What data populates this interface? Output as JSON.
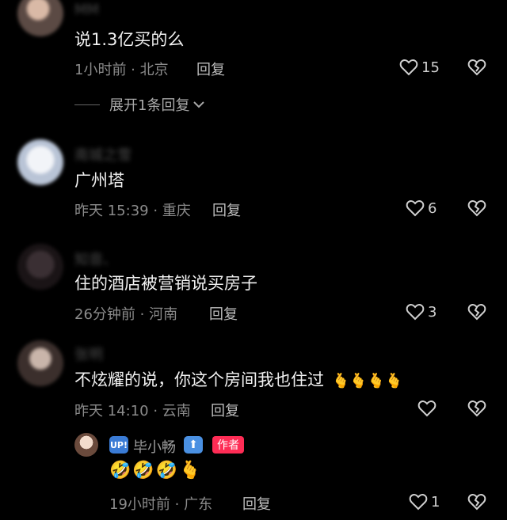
{
  "comments": [
    {
      "username": "MM",
      "text": "说1.3亿买的么",
      "meta": "1小时前 · 北京",
      "reply_label": "回复",
      "likes": "15",
      "expand_label": "展开1条回复"
    },
    {
      "username": "南城之雪",
      "text": "广州塔",
      "meta": "昨天 15:39 · 重庆",
      "reply_label": "回复",
      "likes": "6"
    },
    {
      "username": "知音、",
      "text": "住的酒店被营销说买房子",
      "meta": "26分钟前 · 河南",
      "reply_label": "回复",
      "likes": "3"
    },
    {
      "username": "张明",
      "text": "不炫耀的说，你这个房间我也住过",
      "emojis": "🫰🫰🫰🫰",
      "meta": "昨天 14:10 · 云南",
      "reply_label": "回复",
      "likes": ""
    }
  ],
  "sub_reply": {
    "badge": "UP!",
    "name": "毕小畅",
    "arrow": "⬆",
    "author_tag": "作者",
    "emojis": "🤣🤣🤣🫰",
    "meta": "19小时前 · 广东",
    "reply_label": "回复",
    "likes": "1"
  },
  "icons": {
    "like": "heart-outline-icon",
    "dislike": "broken-heart-icon",
    "expand": "chevron-down-icon"
  },
  "colors": {
    "background": "#000000",
    "author_tag": "#fe2c55",
    "meta_text": "#8b8b8b"
  }
}
